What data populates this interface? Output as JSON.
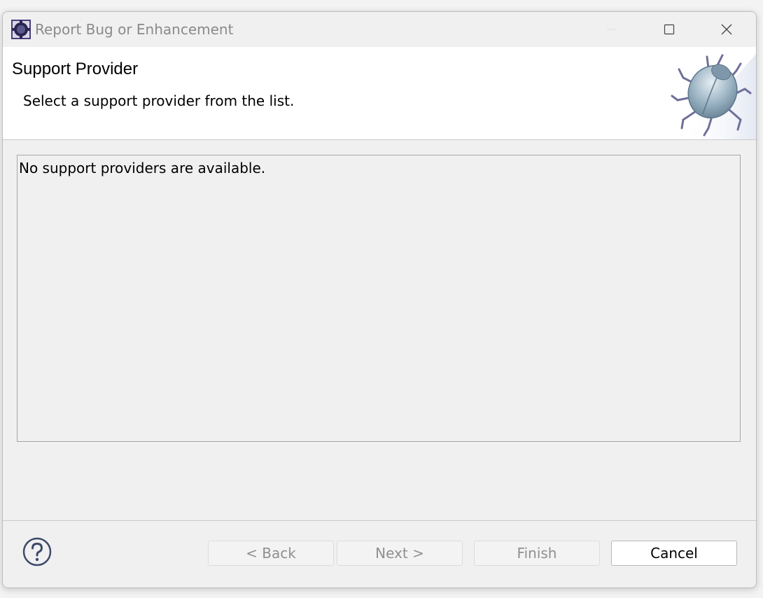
{
  "window": {
    "title": "Report Bug or Enhancement",
    "controls": [
      "minimize-icon",
      "maximize-icon",
      "close-icon"
    ]
  },
  "header": {
    "title": "Support Provider",
    "description": "Select a support provider from the list.",
    "banner_icon": "bug-icon"
  },
  "provider_list": {
    "empty_message": "No support providers are available."
  },
  "footer": {
    "help_icon": "question-mark-icon",
    "buttons": {
      "back": "< Back",
      "next": "Next >",
      "finish": "Finish",
      "cancel": "Cancel"
    }
  },
  "colors": {
    "window_bg": "#f0f0f0",
    "header_bg": "#ffffff",
    "disabled_text": "#8f8f8f",
    "help_blue": "#3e4a6b"
  }
}
